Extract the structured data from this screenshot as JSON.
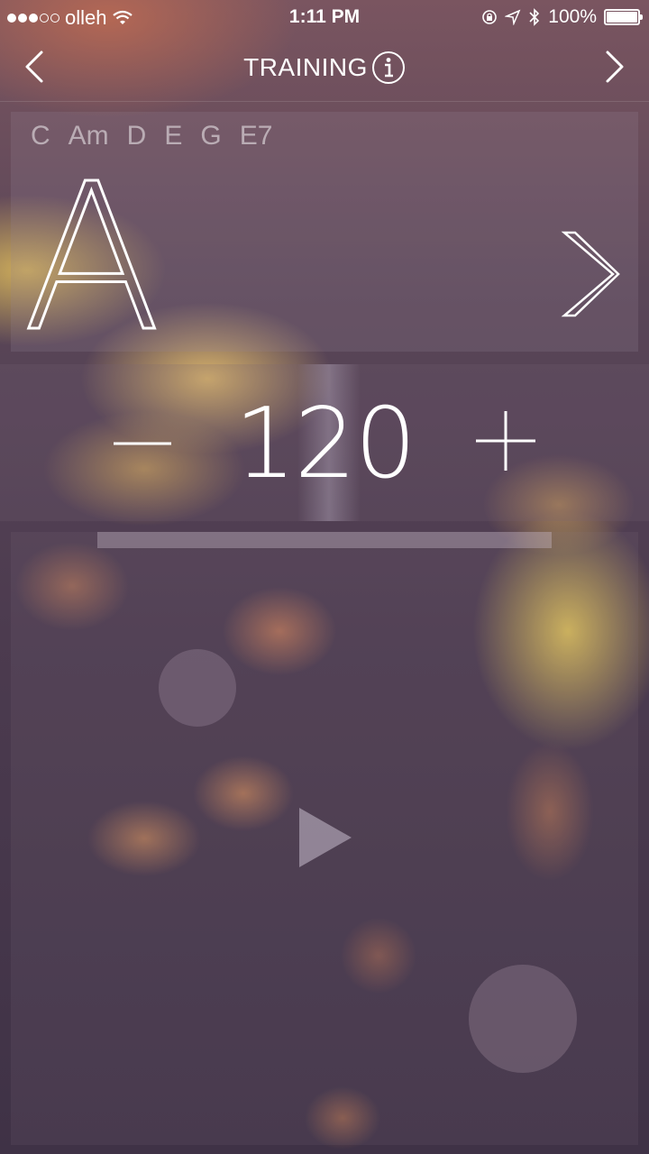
{
  "status_bar": {
    "carrier": "olleh",
    "signal_filled": 3,
    "signal_total": 5,
    "time": "1:11 PM",
    "battery": "100%"
  },
  "nav": {
    "title": "TRAINING",
    "back_icon": "chevron-left-icon",
    "forward_icon": "chevron-right-icon",
    "info_icon": "info-icon"
  },
  "chords": {
    "list": [
      "C",
      "Am",
      "D",
      "E",
      "G",
      "E7"
    ],
    "current": "A",
    "next_icon": "chevron-right-icon"
  },
  "tempo": {
    "value": "120",
    "minus_icon": "minus-icon",
    "plus_icon": "plus-icon"
  },
  "player": {
    "progress": 0,
    "play_icon": "play-icon"
  },
  "colors": {
    "text": "#ffffff",
    "panel": "#8c788c"
  }
}
